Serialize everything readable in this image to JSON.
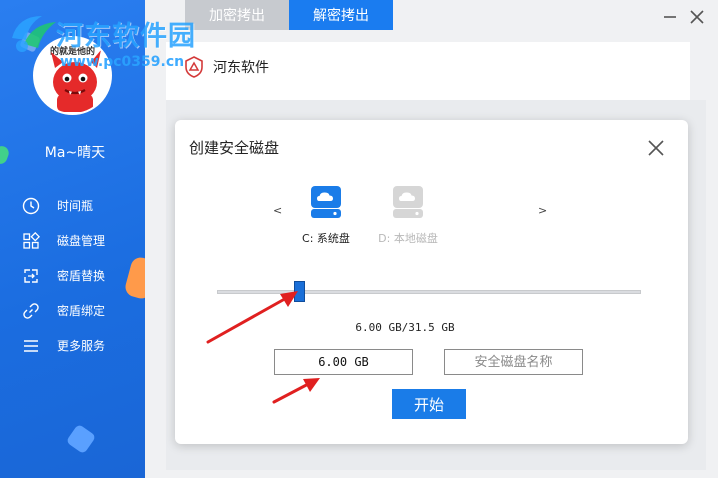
{
  "watermark": {
    "title": "河东软件园",
    "url": "www.pc0359.cn",
    "avatar_text": "的就是他的"
  },
  "sidebar": {
    "username": "Ma~晴天",
    "items": [
      {
        "label": "时间瓶",
        "icon": "clock-icon"
      },
      {
        "label": "磁盘管理",
        "icon": "grid-icon"
      },
      {
        "label": "密盾替换",
        "icon": "swap-icon"
      },
      {
        "label": "密盾绑定",
        "icon": "link-icon"
      },
      {
        "label": "更多服务",
        "icon": "menu-icon"
      }
    ]
  },
  "tabs": {
    "encrypt": "加密拷出",
    "decrypt": "解密拷出",
    "active": "decrypt"
  },
  "brand": {
    "label": "河东软件"
  },
  "modal": {
    "title": "创建安全磁盘",
    "prev": "<",
    "next": ">",
    "disks": [
      {
        "label": "C: 系统盘",
        "active": true
      },
      {
        "label": "D: 本地磁盘",
        "active": false
      }
    ],
    "size_readout": "6.00 GB/31.5 GB",
    "slider_fraction": 0.19,
    "size_value": "6.00 GB",
    "name_placeholder": "安全磁盘名称",
    "start_label": "开始"
  },
  "colors": {
    "accent": "#1a7ce8",
    "sidebar": "#1f73e6",
    "arrow": "#e02020"
  }
}
